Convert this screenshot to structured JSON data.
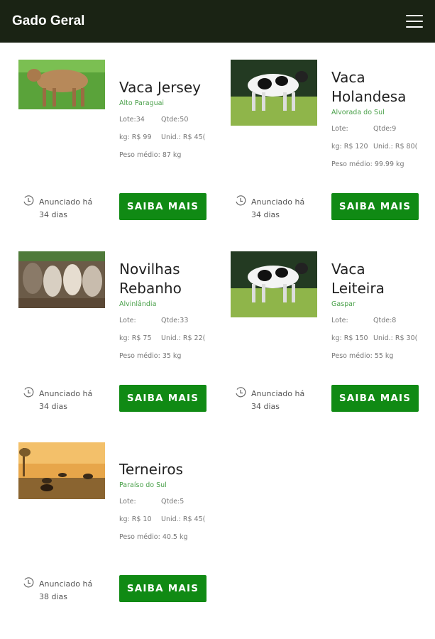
{
  "header": {
    "brand": "Gado Geral"
  },
  "listings": [
    {
      "title": "Vaca Jersey",
      "location": "Alto Paraguai",
      "lote_label": "Lote:34",
      "qtde_label": "Qtde:50",
      "kg_label": "kg: R$ 99",
      "unid_label": "Unid.: R$ 45(",
      "peso_label": "Peso médio: 87 kg",
      "announced_line1": "Anunciado há",
      "announced_line2": "34 dias",
      "button_label": "SAIBA MAIS"
    },
    {
      "title": "Vaca Holandesa",
      "location": "Alvorada do Sul",
      "lote_label": "Lote:",
      "qtde_label": "Qtde:9",
      "kg_label": "kg: R$ 120",
      "unid_label": "Unid.: R$ 80(",
      "peso_label": "Peso médio: 99.99 kg",
      "announced_line1": "Anunciado há",
      "announced_line2": "34 dias",
      "button_label": "SAIBA MAIS"
    },
    {
      "title": "Novilhas Rebanho",
      "location": "Alvinlândia",
      "lote_label": "Lote:",
      "qtde_label": "Qtde:33",
      "kg_label": "kg: R$ 75",
      "unid_label": "Unid.: R$ 22(",
      "peso_label": "Peso médio: 35 kg",
      "announced_line1": "Anunciado há",
      "announced_line2": "34 dias",
      "button_label": "SAIBA MAIS"
    },
    {
      "title": "Vaca Leiteira",
      "location": "Gaspar",
      "lote_label": "Lote:",
      "qtde_label": "Qtde:8",
      "kg_label": "kg: R$ 150",
      "unid_label": "Unid.: R$ 30(",
      "peso_label": "Peso médio: 55 kg",
      "announced_line1": "Anunciado há",
      "announced_line2": "34 dias",
      "button_label": "SAIBA MAIS"
    },
    {
      "title": "Terneiros",
      "location": "Paraíso do Sul",
      "lote_label": "Lote:",
      "qtde_label": "Qtde:5",
      "kg_label": "kg: R$ 10",
      "unid_label": "Unid.: R$ 45(",
      "peso_label": "Peso médio: 40.5 kg",
      "announced_line1": "Anunciado há",
      "announced_line2": "38 dias",
      "button_label": "SAIBA MAIS"
    }
  ],
  "colors": {
    "header_bg": "#1a2314",
    "accent_green": "#108a14",
    "location_green": "#49a049"
  },
  "icons": {
    "menu": "hamburger-menu-icon",
    "clock": "clock-icon"
  }
}
